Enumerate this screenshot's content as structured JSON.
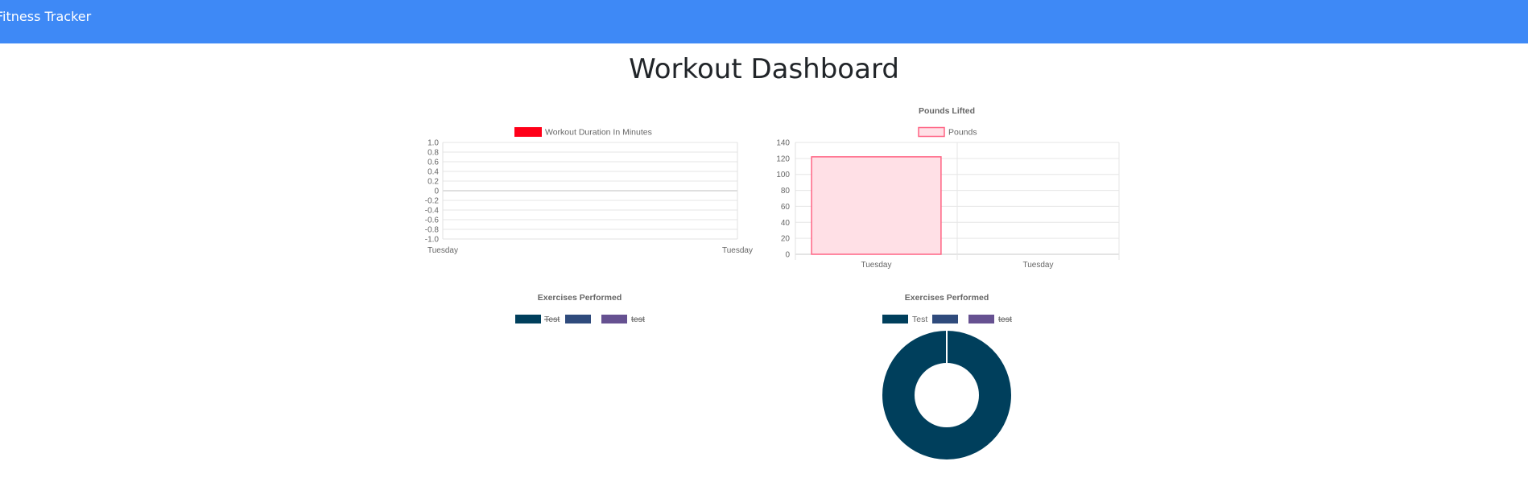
{
  "navbar": {
    "brand": "Fitness Tracker",
    "color": "#3e89f6"
  },
  "page": {
    "title": "Workout Dashboard"
  },
  "chart_data": [
    {
      "type": "line",
      "title": "",
      "legend": [
        {
          "label": "Workout Duration In Minutes",
          "color": "#ff0019"
        }
      ],
      "legend_position": "top",
      "categories": [
        "Tuesday",
        "Tuesday"
      ],
      "series": [
        {
          "name": "Workout Duration In Minutes",
          "values": []
        }
      ],
      "ylim": [
        -1.0,
        1.0
      ],
      "yticks": [
        "1.0",
        "0.8",
        "0.6",
        "0.4",
        "0.2",
        "0",
        "-0.2",
        "-0.4",
        "-0.6",
        "-0.8",
        "-1.0"
      ],
      "grid": true
    },
    {
      "type": "bar",
      "title": "Pounds Lifted",
      "legend": [
        {
          "label": "Pounds",
          "color": "#ff6384",
          "fill": "#ffe0e6"
        }
      ],
      "legend_position": "top",
      "categories": [
        "Tuesday",
        "Tuesday"
      ],
      "series": [
        {
          "name": "Pounds",
          "values": [
            122,
            0
          ]
        }
      ],
      "ylim": [
        0,
        140
      ],
      "yticks": [
        "140",
        "120",
        "100",
        "80",
        "60",
        "40",
        "20",
        "0"
      ],
      "grid": true
    },
    {
      "type": "pie",
      "title": "Exercises Performed",
      "legend": [
        {
          "label": "Test",
          "color": "#003f5c",
          "hidden": true
        },
        {
          "label": "",
          "color": "#2f4b7c",
          "hidden": true
        },
        {
          "label": "test",
          "color": "#665191",
          "hidden": true
        }
      ],
      "legend_position": "top",
      "values": []
    },
    {
      "type": "pie",
      "title": "Exercises Performed",
      "legend": [
        {
          "label": "Test",
          "color": "#003f5c",
          "hidden": false
        },
        {
          "label": "",
          "color": "#2f4b7c",
          "hidden": true
        },
        {
          "label": "test",
          "color": "#665191",
          "hidden": true
        }
      ],
      "legend_position": "top",
      "labels": [
        "Test"
      ],
      "values": [
        1
      ]
    }
  ]
}
